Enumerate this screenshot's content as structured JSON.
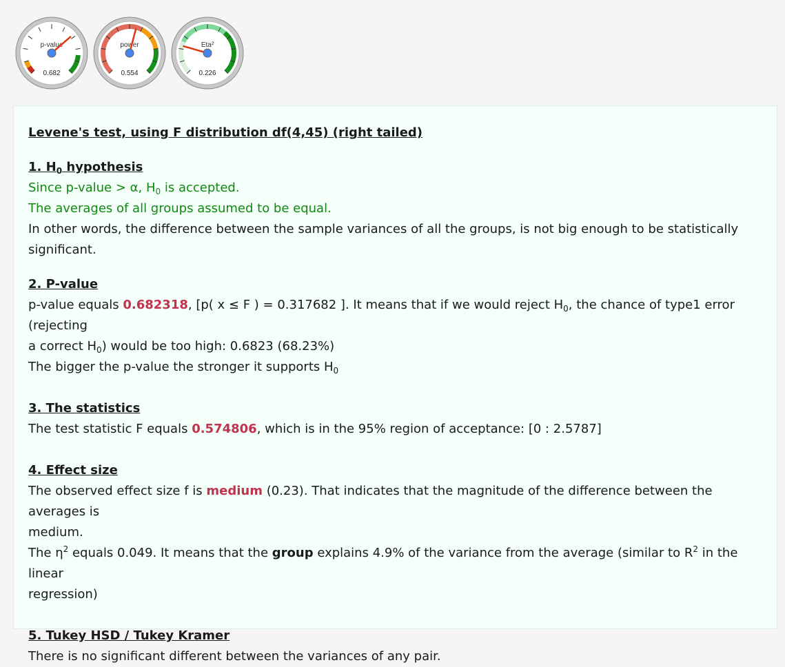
{
  "gauges": [
    {
      "label": "p-value",
      "value": "0.682",
      "fraction": 0.682,
      "bands": [
        {
          "from": 0,
          "to": 0.05,
          "color": "#cc2a1e"
        },
        {
          "from": 0.05,
          "to": 0.1,
          "color": "#f39c12"
        },
        {
          "from": 0.85,
          "to": 1,
          "color": "#15911b"
        }
      ]
    },
    {
      "label": "power",
      "value": "0.554",
      "fraction": 0.554,
      "bands": [
        {
          "from": 0,
          "to": 0.6,
          "color": "#e06b5a"
        },
        {
          "from": 0.6,
          "to": 0.8,
          "color": "#f39c12"
        },
        {
          "from": 0.8,
          "to": 1,
          "color": "#15911b"
        }
      ]
    },
    {
      "label": "Eta²",
      "value": "0.226",
      "fraction": 0.226,
      "bands": [
        {
          "from": 0,
          "to": 0.26,
          "color": "#d9efdc"
        },
        {
          "from": 0.26,
          "to": 0.65,
          "color": "#7dd89a"
        },
        {
          "from": 0.65,
          "to": 1,
          "color": "#15911b"
        }
      ]
    }
  ],
  "report": {
    "title": "Levene's test, using F distribution df(4,45) (right tailed)",
    "s1": {
      "heading_a": "1. H",
      "heading_sub": "0",
      "heading_b": " hypothesis",
      "l1_a": "Since p-value > α, H",
      "l1_sub": "0",
      "l1_b": " is accepted.",
      "l2": "The averages of all groups assumed to be equal.",
      "l3": "In other words, the difference between the sample variances of all the groups, is not big enough to be statistically",
      "l4": "significant."
    },
    "s2": {
      "heading": "2. P-value",
      "l1_a": "p-value equals ",
      "l1_val": "0.682318",
      "l1_b": ", [p( x ≤ F ) = 0.317682 ]. It means that if we would reject H",
      "l1_sub": "0",
      "l1_c": ", the chance of type1 error (rejecting",
      "l2_a": "a correct H",
      "l2_sub": "0",
      "l2_b": ") would be too high: 0.6823 (68.23%)",
      "l3_a": "The bigger the p-value the stronger it supports H",
      "l3_sub": "0"
    },
    "s3": {
      "heading": "3. The statistics",
      "l1_a": "The test statistic F equals ",
      "l1_val": "0.574806",
      "l1_b": ", which is in the 95% region of acceptance: [0 : 2.5787]"
    },
    "s4": {
      "heading": "4. Effect size",
      "l1_a": "The observed effect size f is ",
      "l1_val": "medium",
      "l1_b": " (0.23). That indicates that the magnitude of the difference between the averages is",
      "l2": "medium.",
      "l3_a": "The η",
      "l3_sup": "2",
      "l3_b": " equals 0.049. It means that the ",
      "l3_bold": "group",
      "l3_c": " explains 4.9% of the variance from the average (similar to R",
      "l3_sup2": "2",
      "l3_d": " in the linear",
      "l4": "regression)"
    },
    "s5": {
      "heading": "5. Tukey HSD / Tukey Kramer",
      "l1": "There is no significant different between the variances of any pair."
    }
  }
}
